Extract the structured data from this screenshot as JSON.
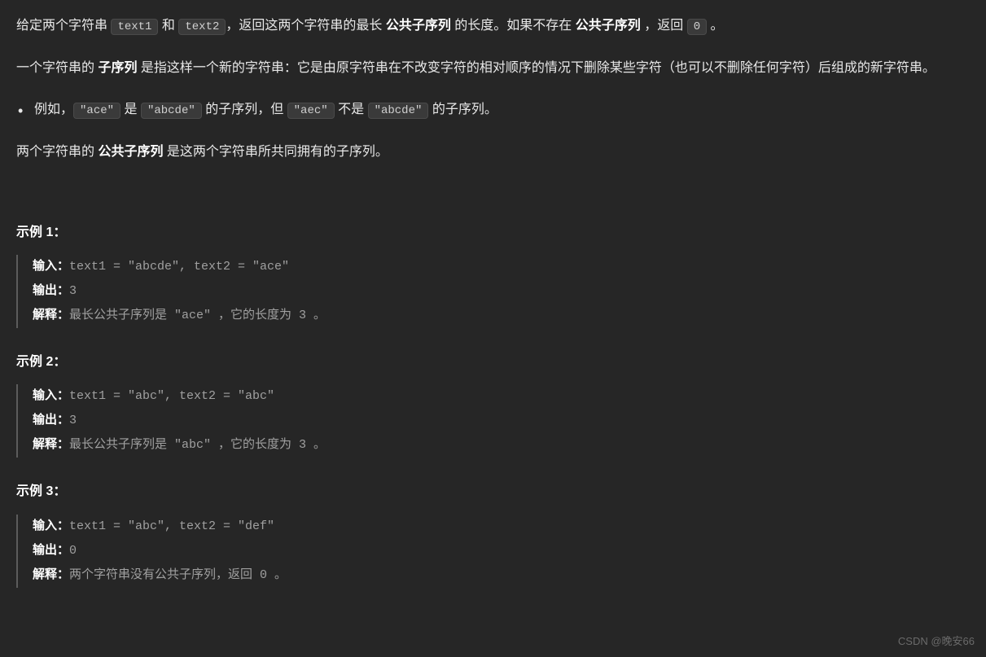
{
  "intro": {
    "p1_part1": "给定两个字符串 ",
    "p1_code1": "text1",
    "p1_part2": " 和 ",
    "p1_code2": "text2",
    "p1_part3": "，返回这两个字符串的最长 ",
    "p1_bold1": "公共子序列",
    "p1_part4": " 的长度。如果不存在 ",
    "p1_bold2": "公共子序列",
    "p1_part5": " ，返回 ",
    "p1_code3": "0",
    "p1_part6": " 。"
  },
  "def": {
    "p2_part1": "一个字符串的 ",
    "p2_bold1": "子序列 ",
    "p2_part2": "是指这样一个新的字符串：它是由原字符串在不改变字符的相对顺序的情况下删除某些字符（也可以不删除任何字符）后组成的新字符串。"
  },
  "bullet": {
    "part1": "例如，",
    "code1": "\"ace\"",
    "part2": " 是 ",
    "code2": "\"abcde\"",
    "part3": " 的子序列，但 ",
    "code3": "\"aec\"",
    "part4": " 不是 ",
    "code4": "\"abcde\"",
    "part5": " 的子序列。"
  },
  "common": {
    "part1": "两个字符串的 ",
    "bold1": "公共子序列",
    "part2": " 是这两个字符串所共同拥有的子序列。"
  },
  "examples": {
    "labels": {
      "input": "输入：",
      "output": "输出：",
      "explain": "解释："
    },
    "ex1": {
      "heading": "示例 1：",
      "input": "text1 = \"abcde\", text2 = \"ace\" ",
      "output": "3 ",
      "explain": "最长公共子序列是 \"ace\" ，它的长度为 3 。"
    },
    "ex2": {
      "heading": "示例 2：",
      "input": "text1 = \"abc\", text2 = \"abc\"",
      "output": "3",
      "explain": "最长公共子序列是 \"abc\" ，它的长度为 3 。"
    },
    "ex3": {
      "heading": "示例 3：",
      "input": "text1 = \"abc\", text2 = \"def\"",
      "output": "0",
      "explain": "两个字符串没有公共子序列，返回 0 。"
    }
  },
  "watermark": "CSDN @晚安66"
}
